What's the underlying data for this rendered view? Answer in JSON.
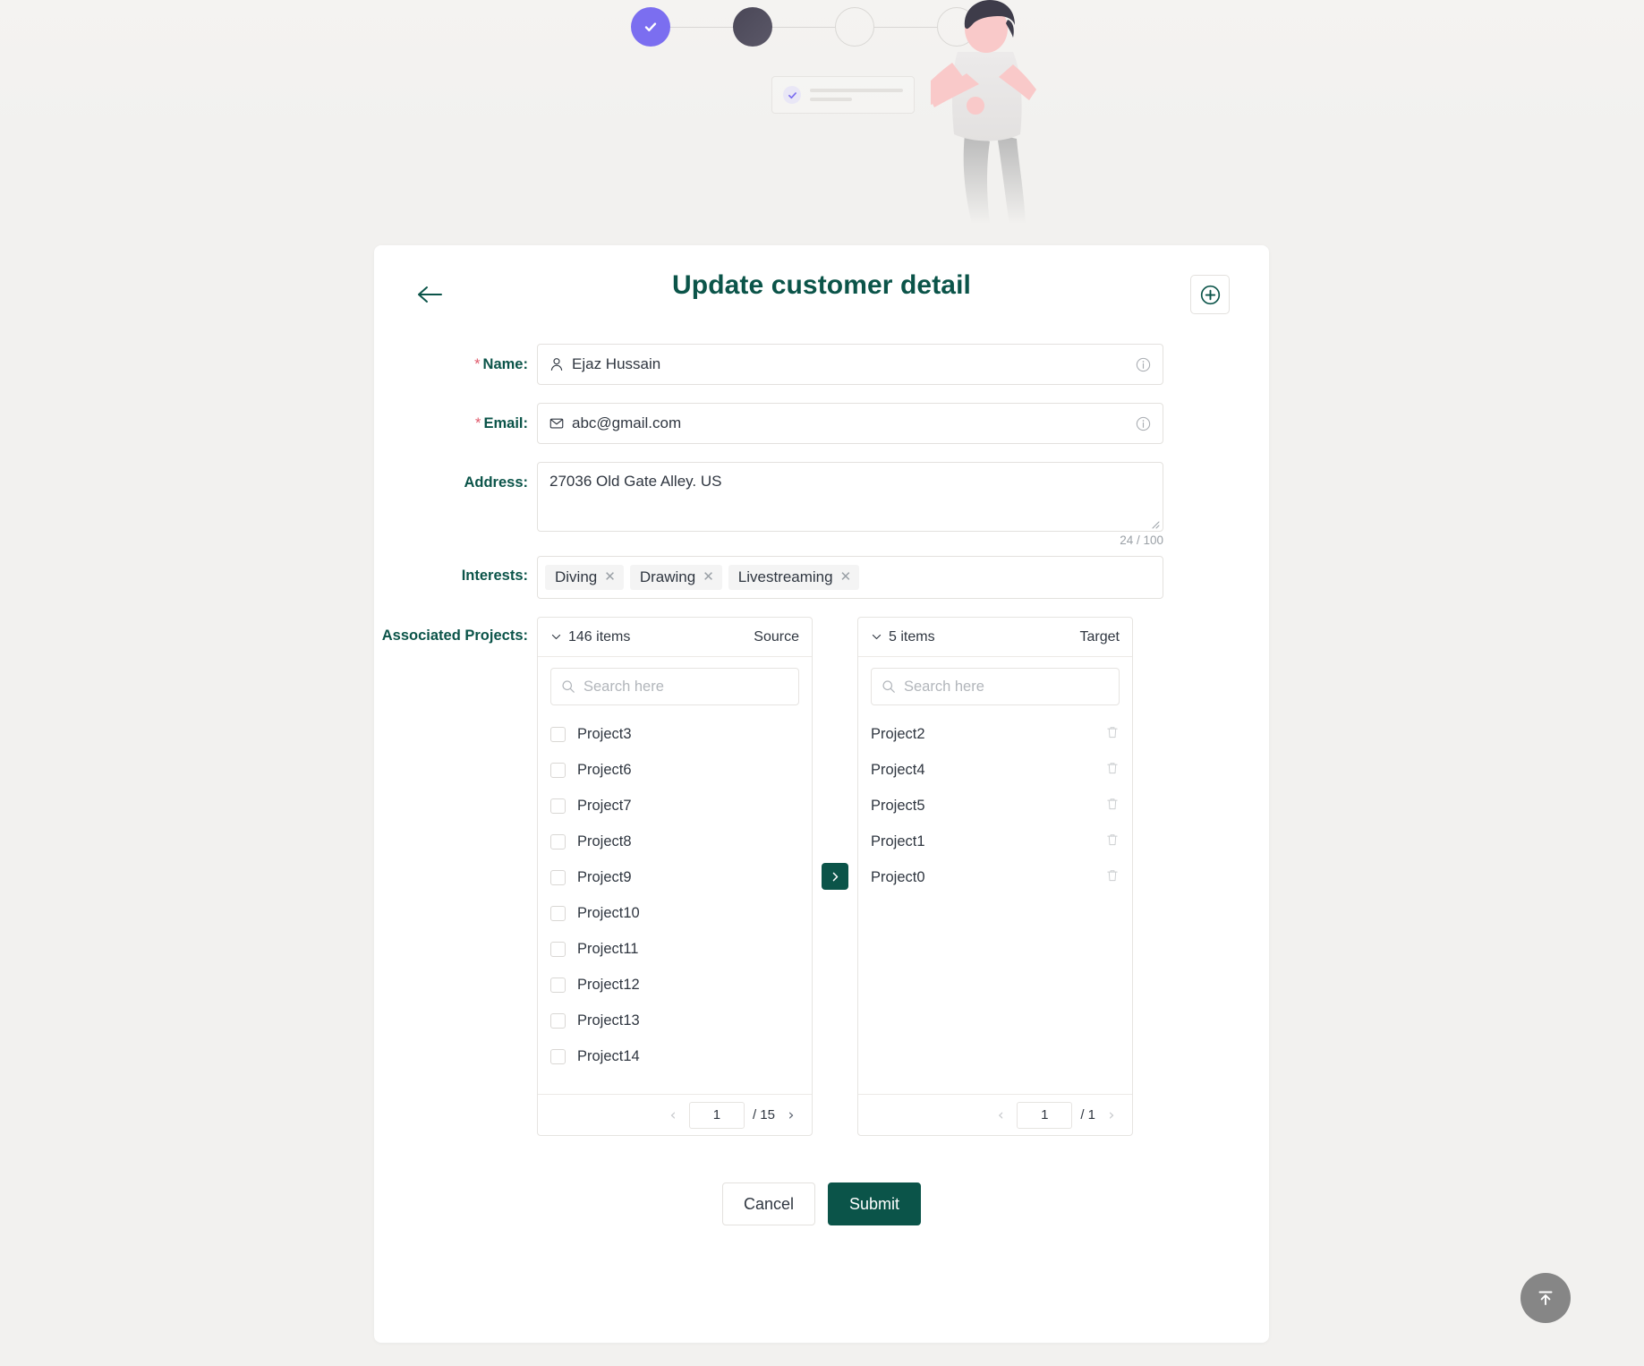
{
  "hero": {
    "steps": [
      {
        "name": "step-1",
        "state": "done"
      },
      {
        "name": "step-2",
        "state": "current"
      },
      {
        "name": "step-3",
        "state": "empty"
      },
      {
        "name": "step-4",
        "state": "empty"
      }
    ],
    "colors": {
      "done": "#7b6ef0",
      "current": "#4f4c5c",
      "empty_border": "#d9d7d4"
    }
  },
  "header": {
    "title": "Update customer detail",
    "back_icon": "arrow-left-icon",
    "add_icon": "plus-circle-icon",
    "title_color": "#0b5449"
  },
  "form": {
    "name": {
      "label": "Name",
      "required": true,
      "value": "Ejaz Hussain",
      "icon": "user-icon",
      "suffix_icon": "info-icon"
    },
    "email": {
      "label": "Email",
      "required": true,
      "value": "abc@gmail.com",
      "icon": "mail-icon",
      "suffix_icon": "info-icon"
    },
    "address": {
      "label": "Address",
      "required": false,
      "value": "27036 Old Gate Alley. US",
      "counter": "24 / 100"
    },
    "interests": {
      "label": "Interests",
      "required": false,
      "tags": [
        "Diving",
        "Drawing",
        "Livestreaming"
      ],
      "remove_icon": "close-icon"
    },
    "associated_projects": {
      "label": "Associated Projects",
      "required": false
    },
    "label_suffix": ":",
    "required_marker": "*"
  },
  "transfer": {
    "source": {
      "count_label": "146 items",
      "side_label": "Source",
      "collapse_icon": "chevron-down-icon",
      "search_placeholder": "Search here",
      "search_icon": "search-icon",
      "items": [
        "Project3",
        "Project6",
        "Project7",
        "Project8",
        "Project9",
        "Project10",
        "Project11",
        "Project12",
        "Project13",
        "Project14"
      ],
      "pagination": {
        "page": "1",
        "total": "/ 15",
        "prev_icon": "chevron-left-icon",
        "next_icon": "chevron-right-icon",
        "prev_enabled": false,
        "next_enabled": true
      }
    },
    "move_button": {
      "icon": "chevron-right-icon",
      "color": "#0b5449"
    },
    "target": {
      "count_label": "5 items",
      "side_label": "Target",
      "collapse_icon": "chevron-down-icon",
      "search_placeholder": "Search here",
      "search_icon": "search-icon",
      "items": [
        "Project2",
        "Project4",
        "Project5",
        "Project1",
        "Project0"
      ],
      "delete_icon": "trash-icon",
      "pagination": {
        "page": "1",
        "total": "/ 1",
        "prev_icon": "chevron-left-icon",
        "next_icon": "chevron-right-icon",
        "prev_enabled": false,
        "next_enabled": false
      }
    }
  },
  "actions": {
    "cancel_label": "Cancel",
    "submit_label": "Submit",
    "submit_color": "#0b5449"
  },
  "fab": {
    "icon": "scroll-to-top-icon",
    "color": "#868686"
  }
}
